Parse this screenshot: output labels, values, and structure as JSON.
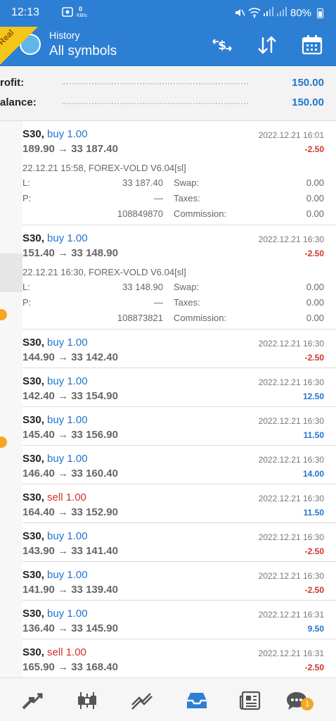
{
  "status_bar": {
    "time": "12:13",
    "net_speed_value": "0",
    "net_speed_unit": "KB/s",
    "battery": "80%"
  },
  "header": {
    "title_small": "History",
    "title_big": "All symbols",
    "badge": "Real"
  },
  "summary": {
    "profit_label": "rofit:",
    "profit_value": "150.00",
    "balance_label": "alance:",
    "balance_value": "150.00"
  },
  "deals": [
    {
      "symbol": "S30,",
      "side": "buy 1.00",
      "side_type": "buy",
      "prices": "189.90 → 33 187.40",
      "time": "2022.12.21 16:01",
      "profit": "-2.50",
      "profit_type": "neg",
      "expanded": true,
      "opened": "22.12.21 15:58, FOREX-VOLD V6.04[sl]",
      "sl_label": "L:",
      "sl_value": "33 187.40",
      "tp_label": "P:",
      "tp_value": "—",
      "id": "108849870",
      "swap_label": "Swap:",
      "swap_value": "0.00",
      "taxes_label": "Taxes:",
      "taxes_value": "0.00",
      "comm_label": "Commission:",
      "comm_value": "0.00"
    },
    {
      "symbol": "S30,",
      "side": "buy 1.00",
      "side_type": "buy",
      "prices": "151.40 → 33 148.90",
      "time": "2022.12.21 16:30",
      "profit": "-2.50",
      "profit_type": "neg",
      "expanded": true,
      "opened": "22.12.21 16:30, FOREX-VOLD V6.04[sl]",
      "sl_label": "L:",
      "sl_value": "33 148.90",
      "tp_label": "P:",
      "tp_value": "—",
      "id": "108873821",
      "swap_label": "Swap:",
      "swap_value": "0.00",
      "taxes_label": "Taxes:",
      "taxes_value": "0.00",
      "comm_label": "Commission:",
      "comm_value": "0.00"
    },
    {
      "symbol": "S30,",
      "side": "buy 1.00",
      "side_type": "buy",
      "prices": "144.90 → 33 142.40",
      "time": "2022.12.21 16:30",
      "profit": "-2.50",
      "profit_type": "neg",
      "expanded": false
    },
    {
      "symbol": "S30,",
      "side": "buy 1.00",
      "side_type": "buy",
      "prices": "142.40 → 33 154.90",
      "time": "2022.12.21 16:30",
      "profit": "12.50",
      "profit_type": "pos",
      "expanded": false
    },
    {
      "symbol": "S30,",
      "side": "buy 1.00",
      "side_type": "buy",
      "prices": "145.40 → 33 156.90",
      "time": "2022.12.21 16:30",
      "profit": "11.50",
      "profit_type": "pos",
      "expanded": false
    },
    {
      "symbol": "S30,",
      "side": "buy 1.00",
      "side_type": "buy",
      "prices": "146.40 → 33 160.40",
      "time": "2022.12.21 16:30",
      "profit": "14.00",
      "profit_type": "pos",
      "expanded": false
    },
    {
      "symbol": "S30,",
      "side": "sell 1.00",
      "side_type": "sell",
      "prices": "164.40 → 33 152.90",
      "time": "2022.12.21 16:30",
      "profit": "11.50",
      "profit_type": "pos",
      "expanded": false
    },
    {
      "symbol": "S30,",
      "side": "buy 1.00",
      "side_type": "buy",
      "prices": "143.90 → 33 141.40",
      "time": "2022.12.21 16:30",
      "profit": "-2.50",
      "profit_type": "neg",
      "expanded": false
    },
    {
      "symbol": "S30,",
      "side": "buy 1.00",
      "side_type": "buy",
      "prices": "141.90 → 33 139.40",
      "time": "2022.12.21 16:30",
      "profit": "-2.50",
      "profit_type": "neg",
      "expanded": false
    },
    {
      "symbol": "S30,",
      "side": "buy 1.00",
      "side_type": "buy",
      "prices": "136.40 → 33 145.90",
      "time": "2022.12.21 16:31",
      "profit": "9.50",
      "profit_type": "pos",
      "expanded": false
    },
    {
      "symbol": "S30,",
      "side": "sell 1.00",
      "side_type": "sell",
      "prices": "165.90 → 33 168.40",
      "time": "2022.12.21 16:31",
      "profit": "-2.50",
      "profit_type": "neg",
      "expanded": false
    }
  ],
  "bottom_nav": {
    "items": [
      "quotes-icon",
      "chart-candles-icon",
      "trade-icon",
      "history-inbox-icon",
      "news-icon",
      "chat-icon"
    ],
    "chat_badge": "1"
  },
  "colors": {
    "accent": "#2d7fd3",
    "buy": "#1f75cc",
    "sell": "#d0312d",
    "badge": "#f5a623"
  }
}
